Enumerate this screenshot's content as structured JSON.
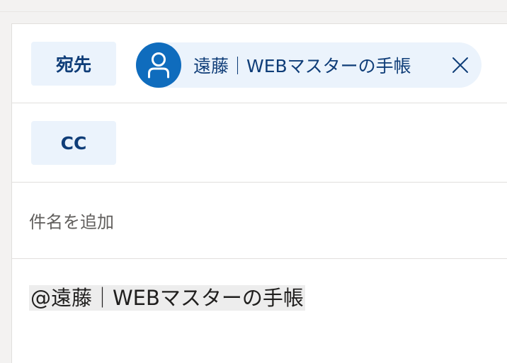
{
  "to": {
    "label": "宛先"
  },
  "recipient": {
    "name": "遠藤｜WEBマスターの手帳",
    "avatar_icon": "person-icon",
    "remove_icon": "close-icon"
  },
  "cc": {
    "label": "CC"
  },
  "subject": {
    "placeholder": "件名を追加",
    "value": ""
  },
  "body": {
    "mention": "@遠藤｜WEBマスターの手帳"
  },
  "colors": {
    "accent": "#0f6cbd",
    "chip_bg": "#ebf3fc",
    "label_text": "#0f3d78"
  }
}
